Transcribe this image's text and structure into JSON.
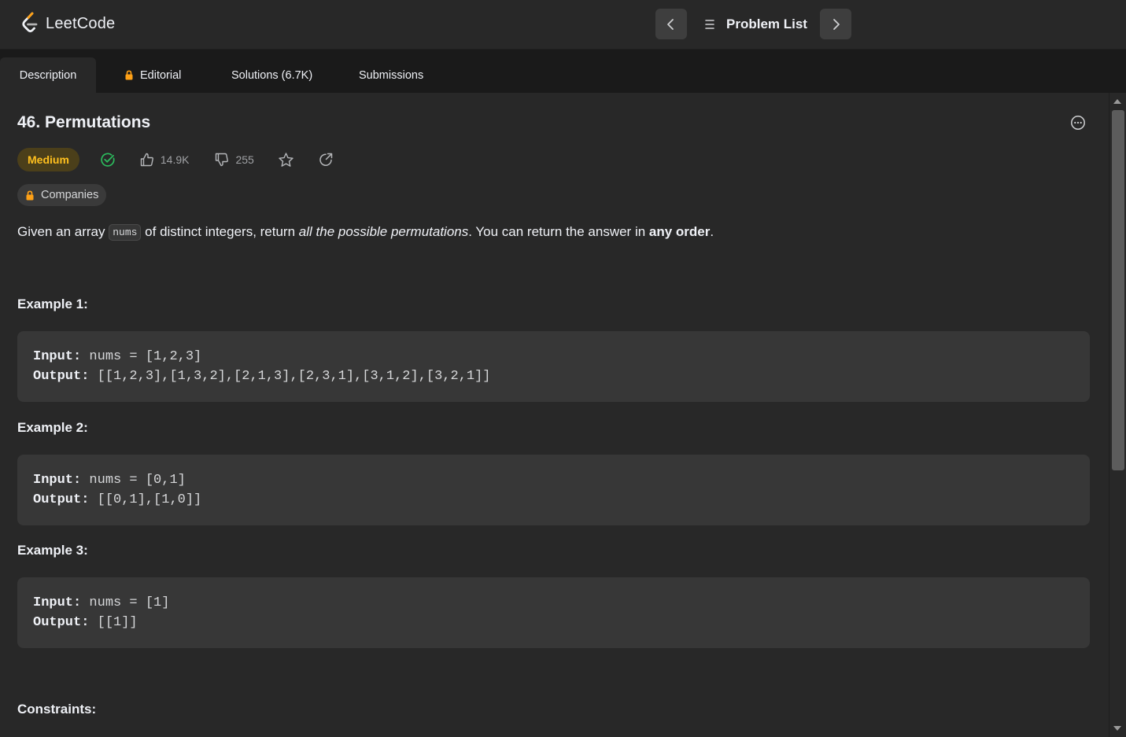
{
  "topbar": {
    "logo_text": "LeetCode",
    "problem_list_label": "Problem List"
  },
  "tabs": [
    {
      "label": "Description",
      "active": true
    },
    {
      "label": "Editorial",
      "locked": true
    },
    {
      "label": "Solutions (6.7K)"
    },
    {
      "label": "Submissions"
    }
  ],
  "problem": {
    "title": "46. Permutations",
    "difficulty": "Medium",
    "likes": "14.9K",
    "dislikes": "255",
    "companies_label": "Companies",
    "description": {
      "part1": "Given an array ",
      "code": "nums",
      "part2": " of distinct integers, return ",
      "italic": "all the possible permutations",
      "part3": ". You can return the answer in ",
      "bold": "any order",
      "part4": "."
    },
    "examples": [
      {
        "heading": "Example 1:",
        "input_label": "Input:",
        "input": "nums = [1,2,3]",
        "output_label": "Output:",
        "output": "[[1,2,3],[1,3,2],[2,1,3],[2,3,1],[3,1,2],[3,2,1]]"
      },
      {
        "heading": "Example 2:",
        "input_label": "Input:",
        "input": "nums = [0,1]",
        "output_label": "Output:",
        "output": "[[0,1],[1,0]]"
      },
      {
        "heading": "Example 3:",
        "input_label": "Input:",
        "input": "nums = [1]",
        "output_label": "Output:",
        "output": "[[1]]"
      }
    ],
    "constraints_heading": "Constraints:"
  },
  "colors": {
    "background": "#282828",
    "tabbar": "#1a1a1a",
    "medium": "#ffc01e",
    "solved": "#2cbb5d",
    "lock": "#ffa116"
  }
}
